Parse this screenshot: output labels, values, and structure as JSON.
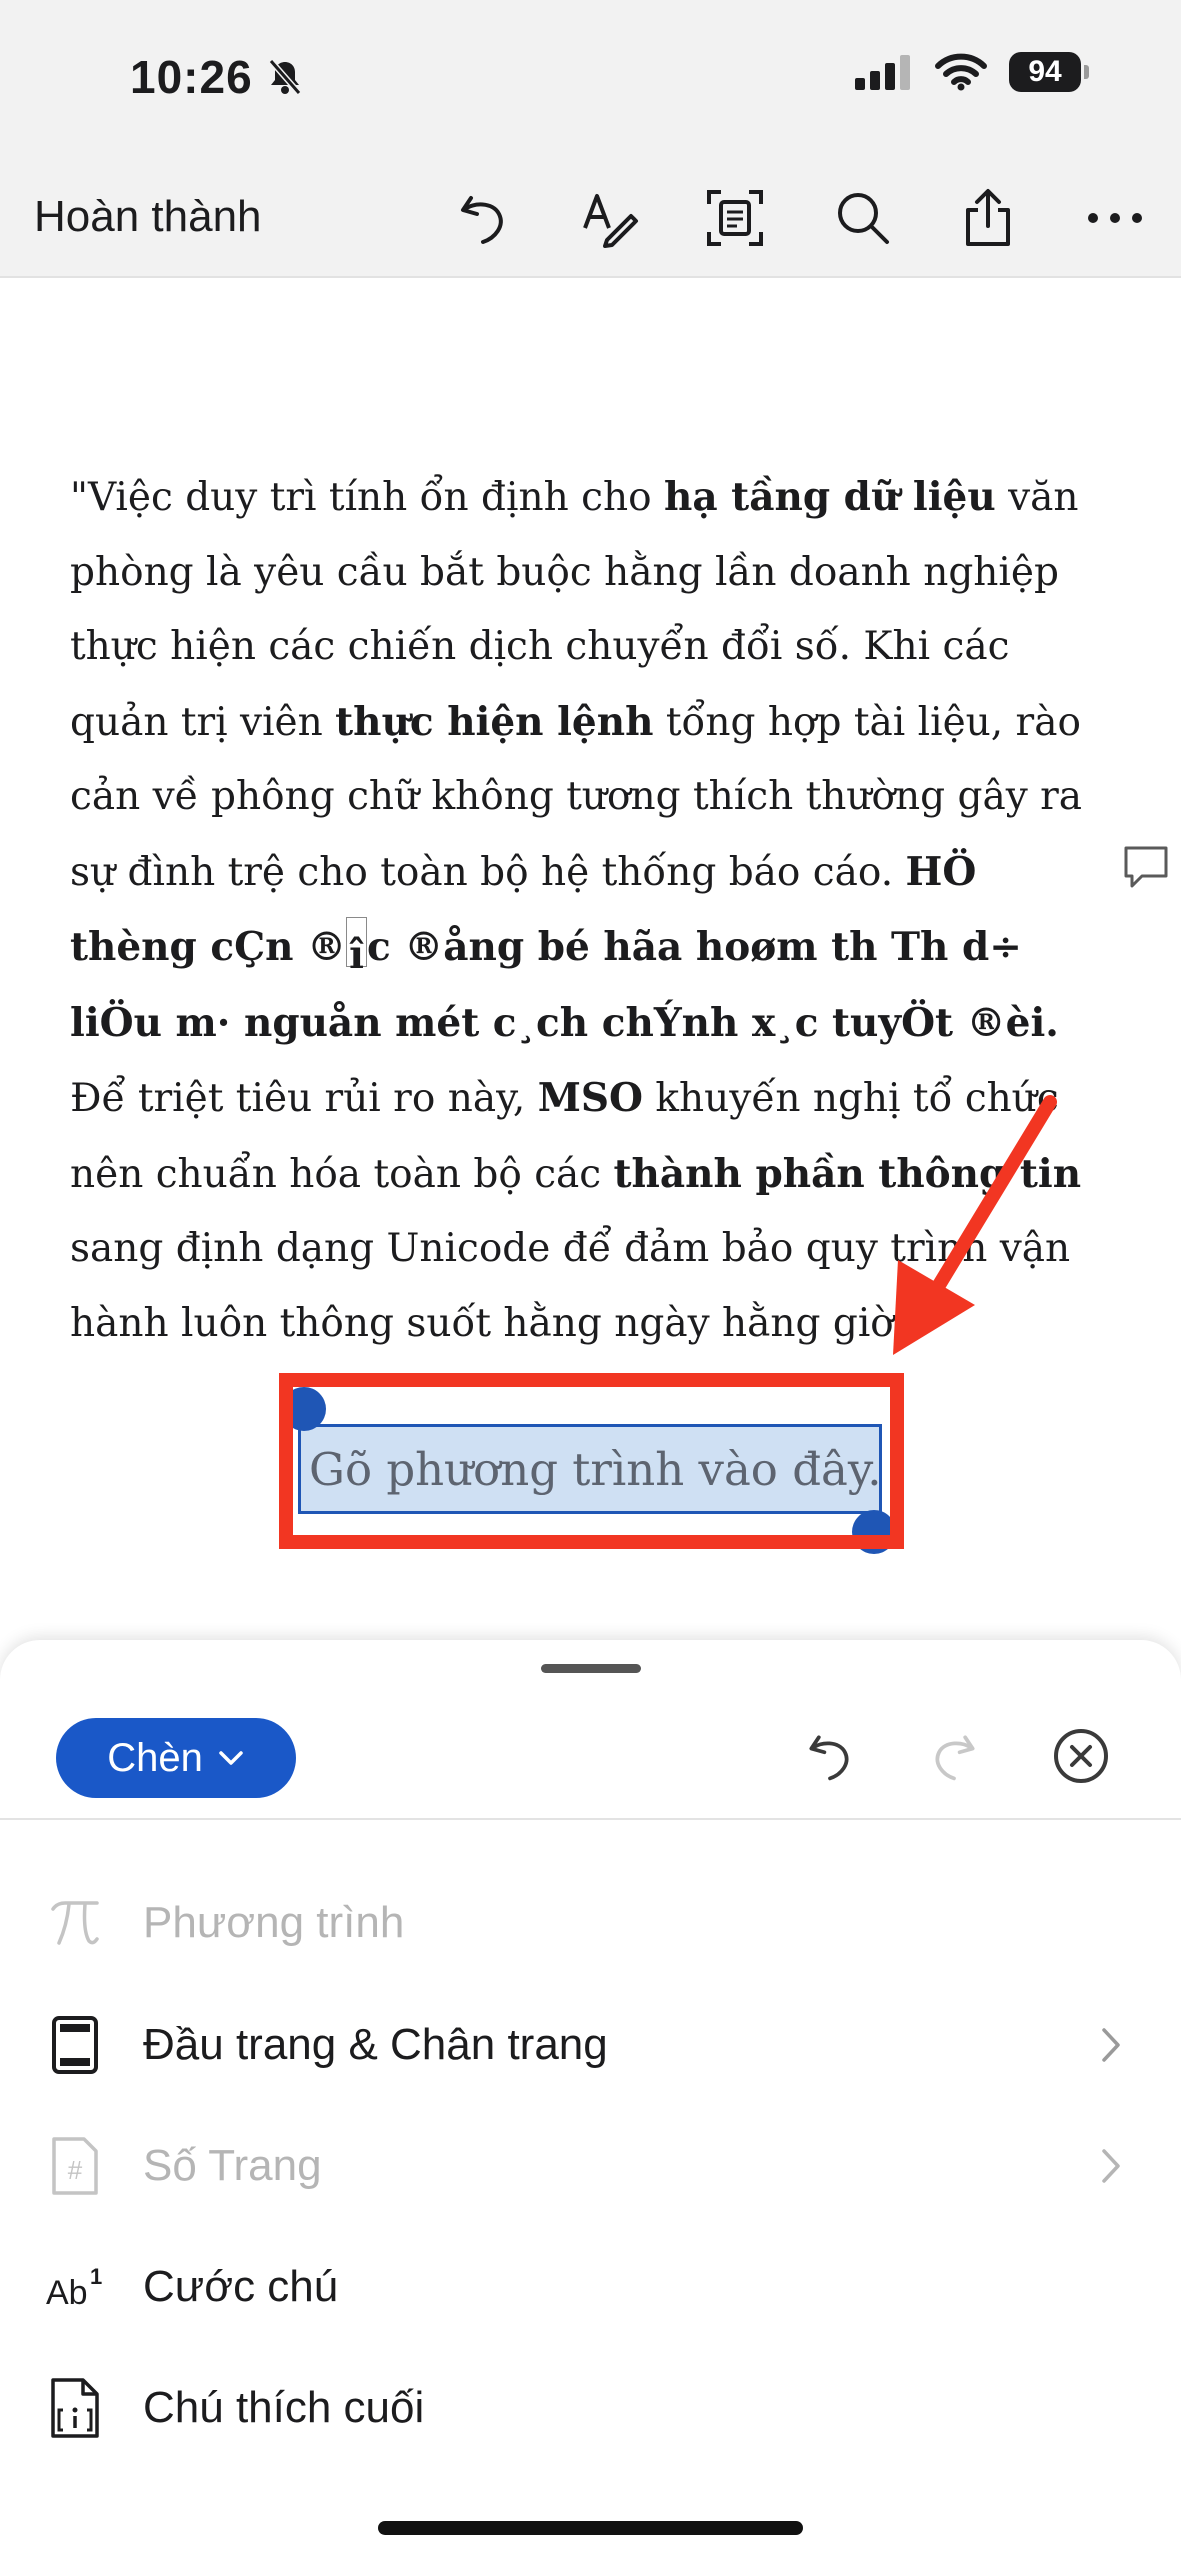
{
  "status_bar": {
    "time": "10:26",
    "battery": "94"
  },
  "toolbar": {
    "done_label": "Hoàn thành"
  },
  "document": {
    "p1": "\"Việc duy trì tính ổn định cho ",
    "b1": "hạ tầng dữ liệu",
    "p2": " văn phòng là yêu cầu bắt buộc hằng lần doanh nghiệp thực hiện các chiến dịch chuyển đổi số. Khi các quản trị viên ",
    "b2": "thực hiện lệnh",
    "p3": " tổng hợp tài liệu, rào cản về phông chữ không tương thích thường gây ra sự đình trệ cho toàn bộ hệ thống báo cáo. ",
    "b3a": "HÖ thèng cÇn ®",
    "b3cursor": "î",
    "b3b": "c ®ång bé hãa hoøm th Th d÷ liÖu m· nguån mét c¸ch chÝnh x¸c tuyÖt ®èi.",
    "p4": " Để triệt tiêu rủi ro này, ",
    "b4": "MSO",
    "p5": " khuyến nghị tổ chức nên chuẩn hóa toàn bộ các ",
    "b5": "thành phần thông tin",
    "p6": " sang định dạng Unicode để đảm bảo quy trình vận hành luôn thông suốt hằng ngày hằng giờ.\""
  },
  "equation": {
    "placeholder": "Gõ phương trình vào đây."
  },
  "sheet": {
    "insert_label": "Chèn",
    "menu": [
      {
        "label": "Phương trình",
        "icon": "pi-icon",
        "enabled": false
      },
      {
        "label": "Đầu trang & Chân trang",
        "icon": "header-footer-icon",
        "enabled": true
      },
      {
        "label": "Số Trang",
        "icon": "page-number-icon",
        "enabled": false
      },
      {
        "label": "Cước chú",
        "icon": "footnote-icon",
        "enabled": true
      },
      {
        "label": "Chú thích cuối",
        "icon": "endnote-icon",
        "enabled": true
      }
    ],
    "footnote_icon_text": "Ab",
    "footnote_icon_sup": "1",
    "page_number_icon_text": "#"
  },
  "colors": {
    "accent": "#1a58c8",
    "annotation_red": "#f23622",
    "selection_fill": "#cfe0f3"
  }
}
